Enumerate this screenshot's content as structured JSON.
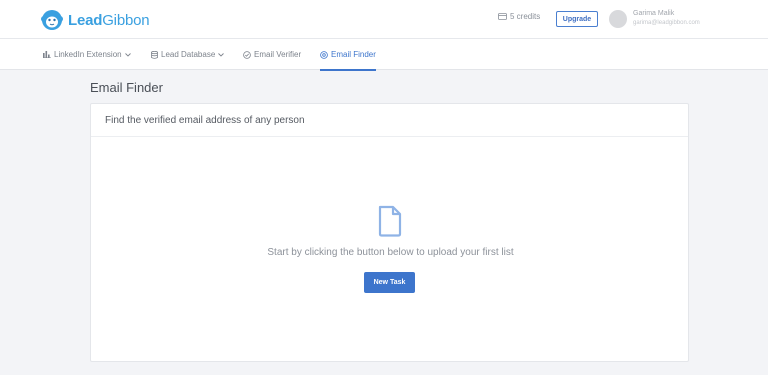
{
  "brand": {
    "name_bold": "Lead",
    "name_regular": "Gibbon",
    "color": "#3aa0e0"
  },
  "header": {
    "credits": "5 credits",
    "upgrade_label": "Upgrade",
    "user_name": "Garima Malik",
    "user_email": "garima@leadgibbon.com"
  },
  "nav": {
    "items": [
      {
        "label": "LinkedIn Extension",
        "icon": "bar-chart-icon",
        "has_dropdown": true
      },
      {
        "label": "Lead Database",
        "icon": "database-icon",
        "has_dropdown": true
      },
      {
        "label": "Email Verifier",
        "icon": "check-circle-icon",
        "has_dropdown": false
      },
      {
        "label": "Email Finder",
        "icon": "at-sign-icon",
        "has_dropdown": false,
        "active": true
      }
    ]
  },
  "page": {
    "title": "Email Finder"
  },
  "card": {
    "header": "Find the verified email address of any person",
    "empty_icon": "document-icon",
    "empty_message": "Start by clicking the button below to upload your first list",
    "button_label": "New Task"
  },
  "colors": {
    "accent": "#3d75cc",
    "background": "#f3f4f7"
  }
}
